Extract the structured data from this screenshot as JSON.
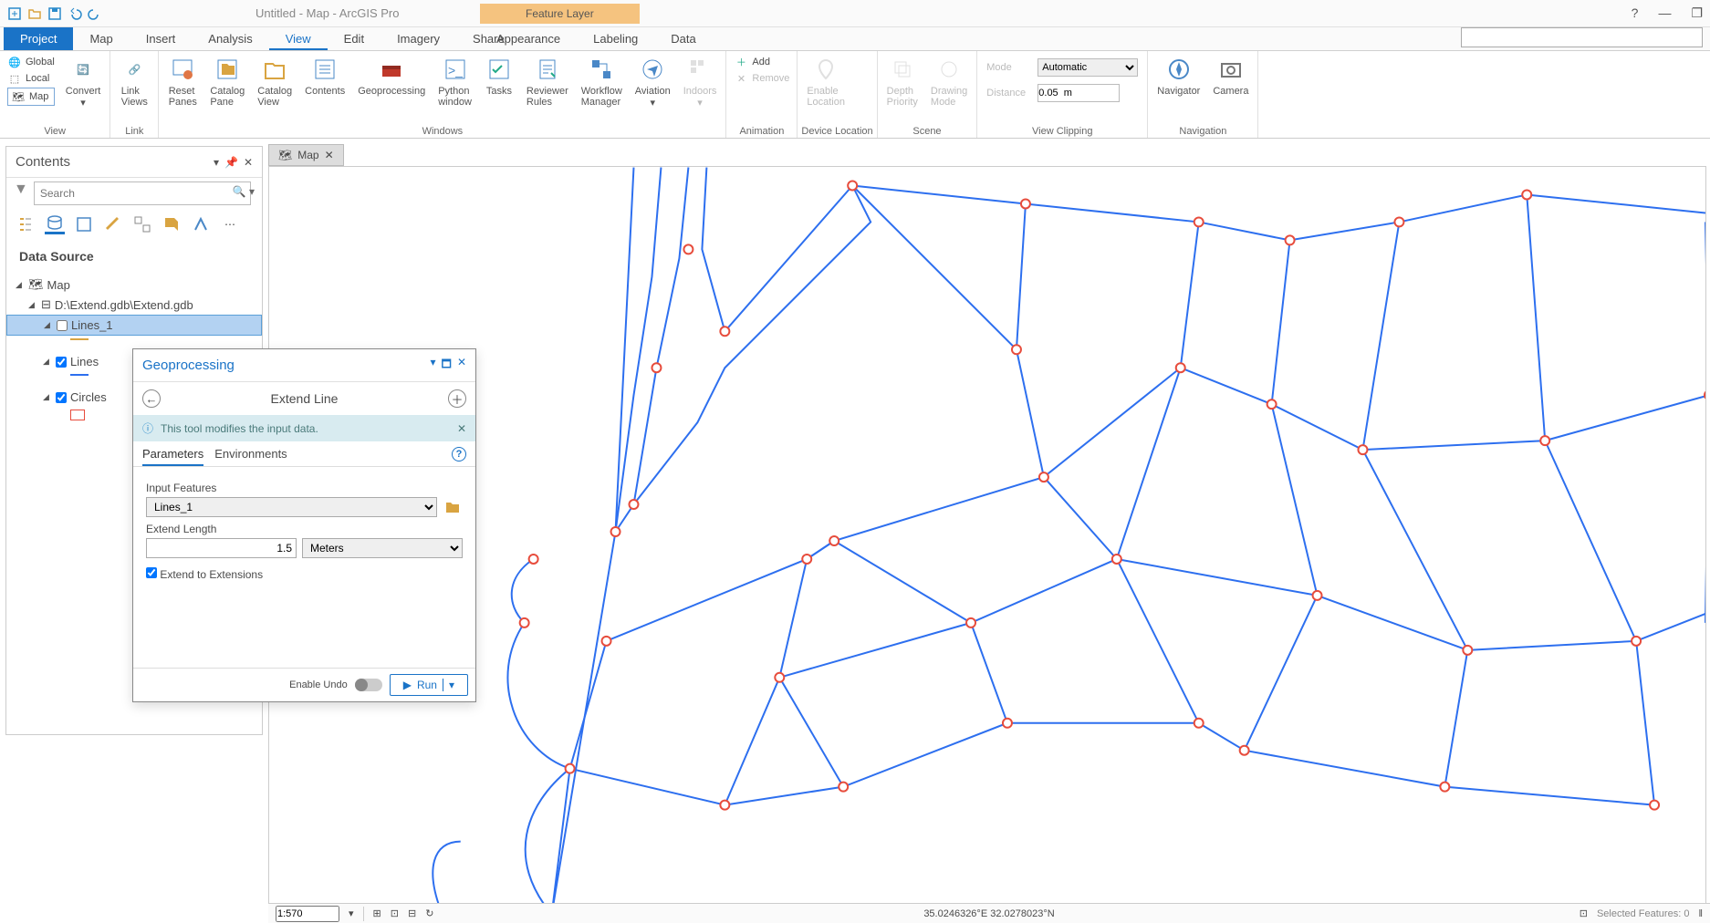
{
  "app": {
    "title": "Untitled - Map - ArcGIS Pro",
    "contextual_label": "Feature Layer"
  },
  "ribbon_tabs": {
    "file": "Project",
    "items": [
      "Map",
      "Insert",
      "Analysis",
      "View",
      "Edit",
      "Imagery",
      "Share"
    ],
    "active": "View",
    "contextual": [
      "Appearance",
      "Labeling",
      "Data"
    ]
  },
  "ribbon": {
    "view": {
      "global": "Global",
      "local": "Local",
      "map": "Map",
      "convert": "Convert",
      "label": "View"
    },
    "link": {
      "link_views": "Link\nViews",
      "label": "Link"
    },
    "windows": {
      "reset_panes": "Reset\nPanes",
      "catalog_pane": "Catalog\nPane",
      "catalog_view": "Catalog\nView",
      "contents": "Contents",
      "geoprocessing": "Geoprocessing",
      "python": "Python\nwindow",
      "tasks": "Tasks",
      "reviewer": "Reviewer\nRules",
      "workflow": "Workflow\nManager",
      "aviation": "Aviation",
      "indoors": "Indoors",
      "label": "Windows"
    },
    "animation": {
      "add": "Add",
      "remove": "Remove",
      "label": "Animation"
    },
    "device": {
      "enable": "Enable\nLocation",
      "label": "Device Location"
    },
    "scene": {
      "depth": "Depth\nPriority",
      "drawing": "Drawing\nMode",
      "label": "Scene"
    },
    "clipping": {
      "mode_label": "Mode",
      "mode_value": "Automatic",
      "dist_label": "Distance",
      "dist_value": "0.05  m",
      "label": "View Clipping"
    },
    "nav": {
      "navigator": "Navigator",
      "camera": "Camera",
      "label": "Navigation"
    }
  },
  "contents": {
    "title": "Contents",
    "search_placeholder": "Search",
    "section": "Data Source",
    "map": "Map",
    "gdb": "D:\\Extend.gdb\\Extend.gdb",
    "layer1": "Lines_1",
    "layer2": "Lines",
    "layer3": "Circles"
  },
  "map_tab": "Map",
  "gp": {
    "title": "Geoprocessing",
    "tool": "Extend Line",
    "info": "This tool modifies the input data.",
    "tab_params": "Parameters",
    "tab_env": "Environments",
    "input_features_label": "Input Features",
    "input_features_value": "Lines_1",
    "extend_length_label": "Extend Length",
    "extend_length_value": "1.5",
    "extend_length_unit": "Meters",
    "extend_ext": "Extend to Extensions",
    "enable_undo": "Enable Undo",
    "run": "Run"
  },
  "status": {
    "scale": "1:570",
    "coords": "35.0246326°E 32.0278023°N",
    "selected": "Selected Features: 0"
  },
  "colors": {
    "accent": "#1a73c7",
    "line": "#2d6fef",
    "node": "#e74c3c"
  }
}
